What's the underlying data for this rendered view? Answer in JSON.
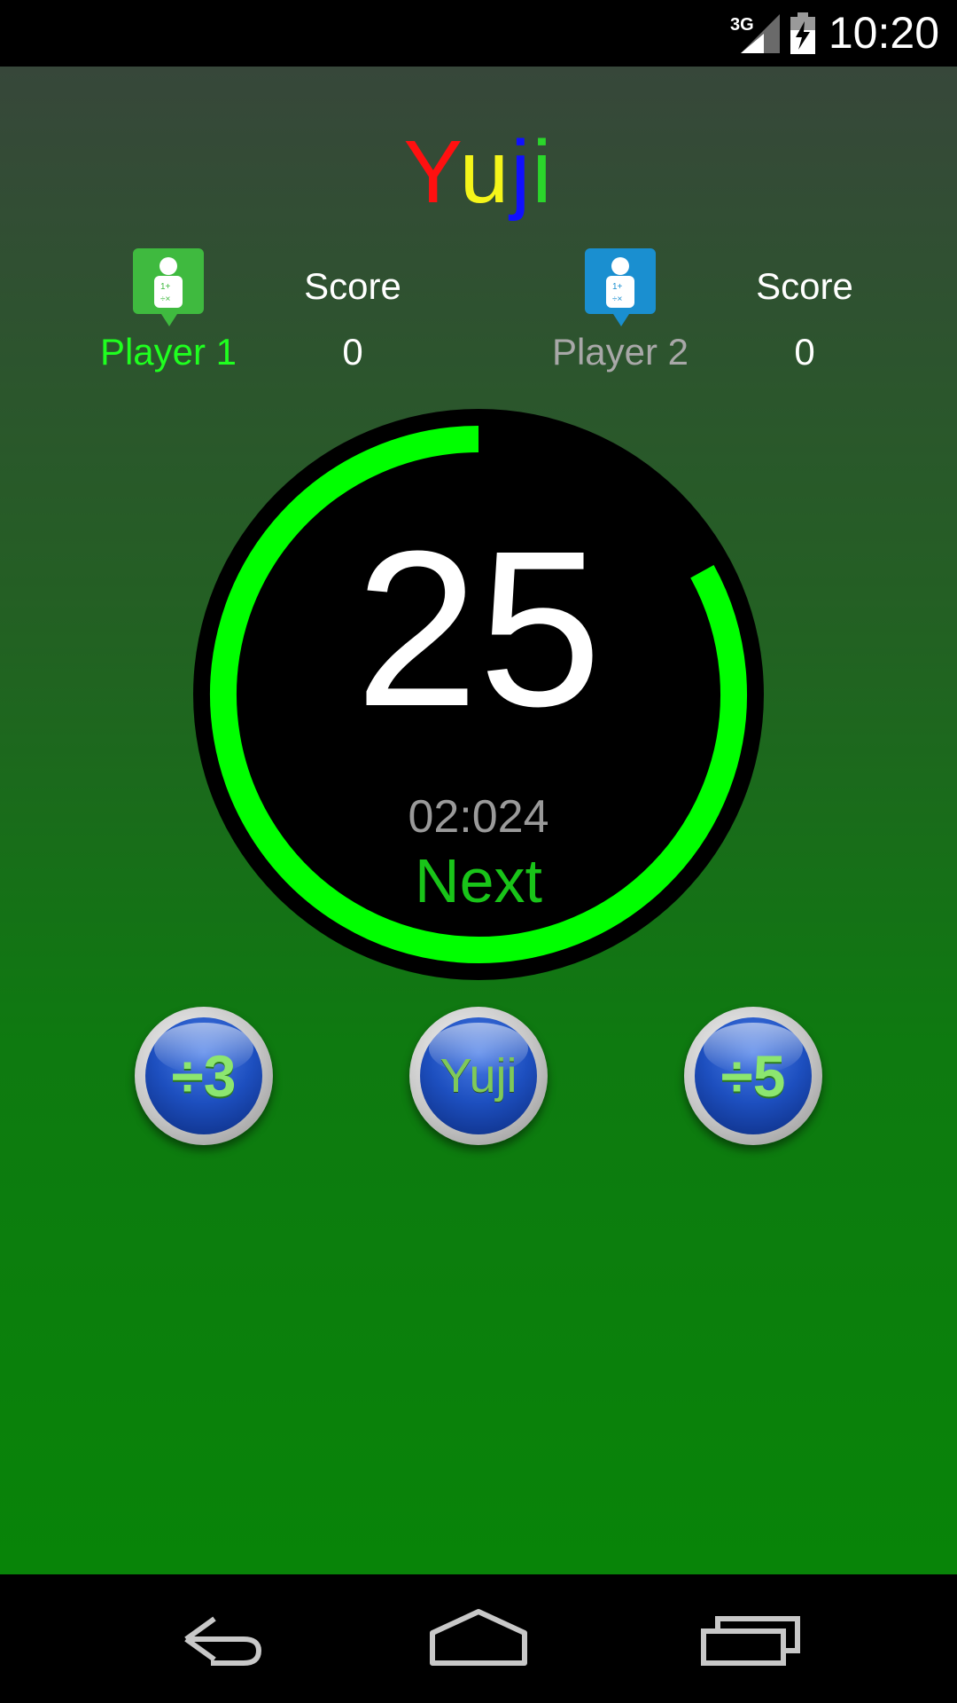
{
  "status_bar": {
    "network": "3G",
    "time": "10:20"
  },
  "app": {
    "title_letters": [
      {
        "char": "Y",
        "color": "#ff1010"
      },
      {
        "char": "u",
        "color": "#f5f51a"
      },
      {
        "char": "j",
        "color": "#1010ff"
      },
      {
        "char": "i",
        "color": "#2bd62b"
      }
    ]
  },
  "players": [
    {
      "name": "Player 1",
      "score_label": "Score",
      "score": "0",
      "name_color": "#1fff1f",
      "icon_color": "#3fba3f",
      "icon": "player-icon"
    },
    {
      "name": "Player 2",
      "score_label": "Score",
      "score": "0",
      "name_color": "#a8a8a8",
      "icon_color": "#1a8fd0",
      "icon": "player-icon"
    }
  ],
  "timer": {
    "count": "25",
    "elapsed": "02:024",
    "next_label": "Next",
    "progress_fraction": 0.83,
    "ring_color": "#00ff00"
  },
  "buttons": [
    {
      "label": "÷3",
      "style": "symbol"
    },
    {
      "label": "Yuji",
      "style": "word"
    },
    {
      "label": "÷5",
      "style": "symbol"
    }
  ],
  "navigation": [
    "back-icon",
    "home-icon",
    "recents-icon"
  ]
}
